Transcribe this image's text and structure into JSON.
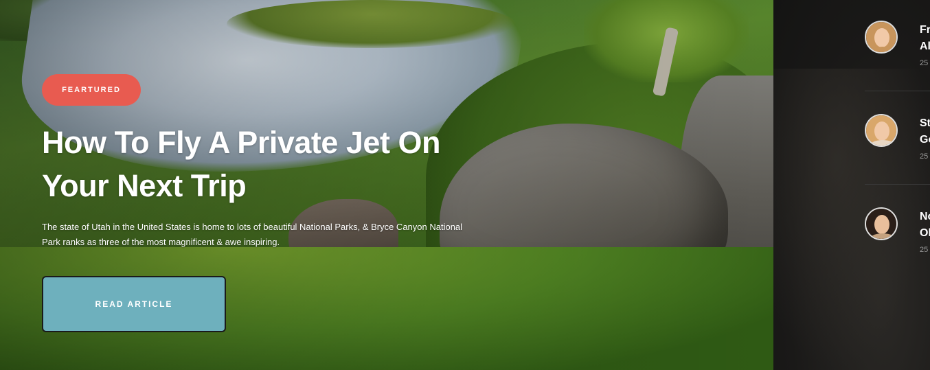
{
  "hero": {
    "badge": "FEARTURED",
    "title": "How To Fly A Private Jet On Your Next Trip",
    "excerpt": "The state of Utah in the United States is home to lots of beautiful National Parks, & Bryce Canyon National Park ranks as three of the most magnificent & awe inspiring.",
    "cta": "READ ARTICLE",
    "colors": {
      "badge": "#e85b50",
      "cta": "#6eb0bd"
    }
  },
  "sidebar": {
    "posts": [
      {
        "title_line1": "Fr",
        "title_line2": "Al",
        "date": "25"
      },
      {
        "title_line1": "St",
        "title_line2": "Ge",
        "date": "25"
      },
      {
        "title_line1": "No",
        "title_line2": "Ol",
        "date": "25"
      }
    ]
  }
}
